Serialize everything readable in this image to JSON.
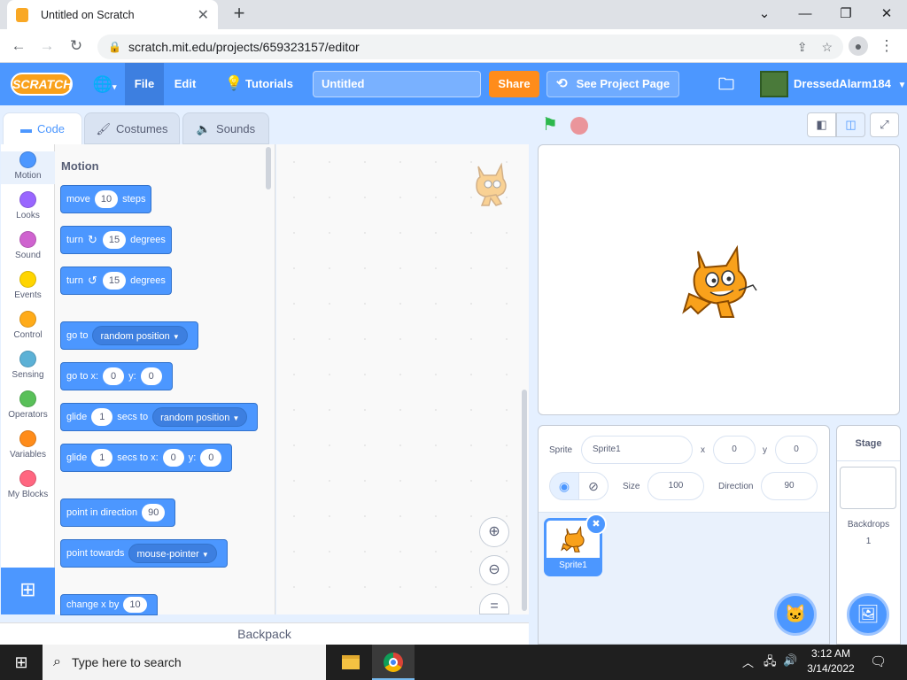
{
  "browser": {
    "tab_title": "Untitled on Scratch",
    "url": "scratch.mit.edu/projects/659323157/editor",
    "new_tab": "+",
    "close_tab": "✕"
  },
  "menu": {
    "logo": "SCRATCH",
    "file": "File",
    "edit": "Edit",
    "tutorials": "Tutorials",
    "project_title": "Untitled",
    "share": "Share",
    "see_project_page": "See Project Page",
    "username": "DressedAlarm184"
  },
  "editor_tabs": {
    "code": "Code",
    "costumes": "Costumes",
    "sounds": "Sounds"
  },
  "categories": [
    {
      "label": "Motion",
      "color": "#4c97ff"
    },
    {
      "label": "Looks",
      "color": "#9966ff"
    },
    {
      "label": "Sound",
      "color": "#cf63cf"
    },
    {
      "label": "Events",
      "color": "#ffd500"
    },
    {
      "label": "Control",
      "color": "#ffab19"
    },
    {
      "label": "Sensing",
      "color": "#5cb1d6"
    },
    {
      "label": "Operators",
      "color": "#59c059"
    },
    {
      "label": "Variables",
      "color": "#ff8c1a"
    },
    {
      "label": "My Blocks",
      "color": "#ff6680"
    }
  ],
  "palette": {
    "section_title": "Motion",
    "blocks": {
      "move": {
        "pre": "move",
        "val": "10",
        "post": "steps"
      },
      "turn_right": {
        "pre": "turn",
        "val": "15",
        "post": "degrees"
      },
      "turn_left": {
        "pre": "turn",
        "val": "15",
        "post": "degrees"
      },
      "goto": {
        "pre": "go to",
        "drop": "random position"
      },
      "goto_xy": {
        "pre": "go to x:",
        "x": "0",
        "mid": "y:",
        "y": "0"
      },
      "glide_to": {
        "pre": "glide",
        "val": "1",
        "mid": "secs to",
        "drop": "random position"
      },
      "glide_xy": {
        "pre": "glide",
        "val": "1",
        "mid": "secs to x:",
        "x": "0",
        "mid2": "y:",
        "y": "0"
      },
      "point_dir": {
        "pre": "point in direction",
        "val": "90"
      },
      "point_towards": {
        "pre": "point towards",
        "drop": "mouse-pointer"
      },
      "change_x": {
        "pre": "change x by",
        "val": "10"
      }
    }
  },
  "backpack": "Backpack",
  "sprite_info": {
    "sprite_label": "Sprite",
    "sprite_name": "Sprite1",
    "x_label": "x",
    "x_value": "0",
    "y_label": "y",
    "y_value": "0",
    "size_label": "Size",
    "size_value": "100",
    "direction_label": "Direction",
    "direction_value": "90"
  },
  "sprite_list": [
    {
      "name": "Sprite1"
    }
  ],
  "stage_pane": {
    "title": "Stage",
    "backdrops_label": "Backdrops",
    "backdrops_count": "1"
  },
  "taskbar": {
    "search_placeholder": "Type here to search",
    "time": "3:12 AM",
    "date": "3/14/2022"
  }
}
